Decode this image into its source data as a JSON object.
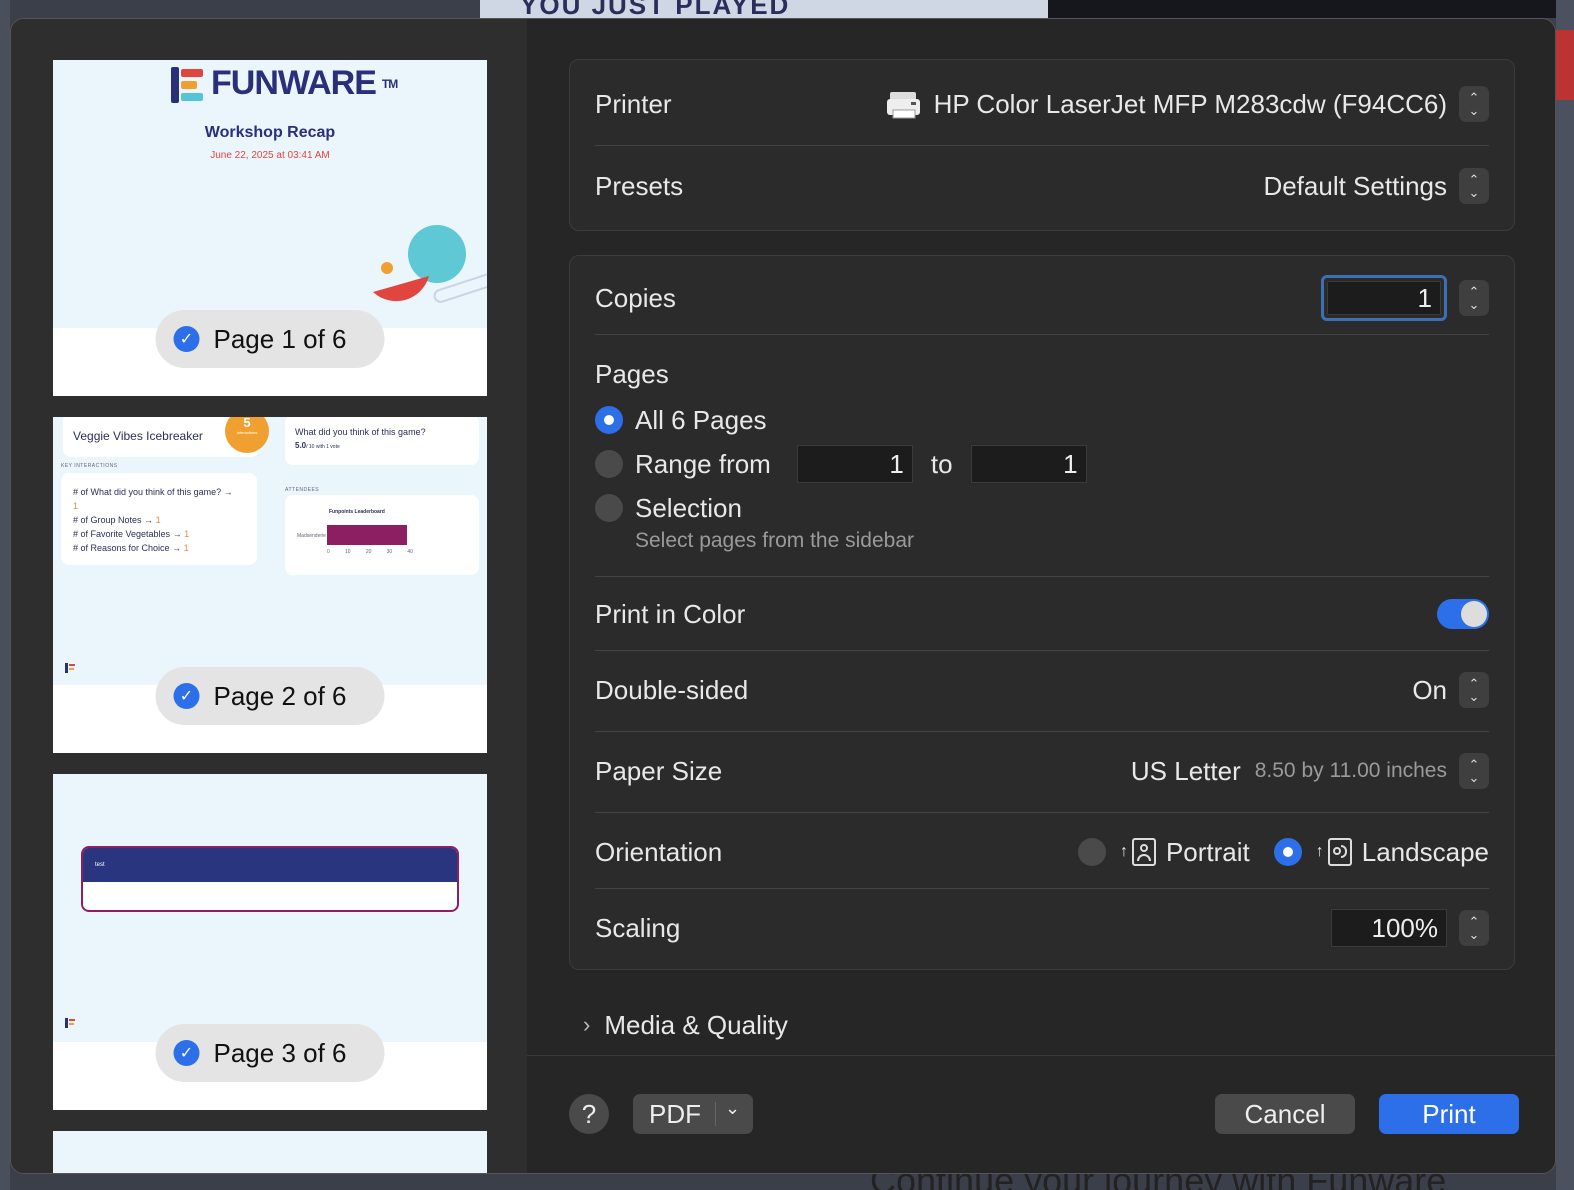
{
  "backdrop": {
    "top_text": "YOU JUST PLAYED",
    "bottom_text": "Continue your journey with Funware"
  },
  "sidebar": {
    "pages": [
      {
        "label": "Page 1 of 6"
      },
      {
        "label": "Page 2 of 6"
      },
      {
        "label": "Page 3 of 6"
      }
    ],
    "page1": {
      "logo_text": "FUNWARE",
      "logo_tm": "TM",
      "title": "Workshop Recap",
      "date": "June 22, 2025 at 03:41 AM"
    },
    "page2": {
      "game_title": "Veggie Vibes Icebreaker",
      "badge_count": "5",
      "badge_label": "Interactions",
      "question": "What did you think of this game?",
      "rating": "5.0",
      "rating_sub": "/ 10  with 1 vote",
      "key_interactions_label": "KEY INTERACTIONS",
      "interactions": [
        {
          "text": "# of What did you think of this game? →",
          "count": "1"
        },
        {
          "text": "# of Group Notes →",
          "count": "1"
        },
        {
          "text": "# of Favorite Vegetables →",
          "count": "1"
        },
        {
          "text": "# of Reasons for Choice →",
          "count": "1"
        }
      ],
      "attendees_label": "ATTENDEES",
      "leaderboard_title": "Funpoints Leaderboard",
      "leaderboard_name": "Madsenderie",
      "axis_ticks": [
        "0",
        "10",
        "20",
        "30",
        "40"
      ]
    },
    "page3": {
      "banner_text": "test"
    }
  },
  "printer": {
    "label": "Printer",
    "value": "HP Color LaserJet MFP M283cdw (F94CC6)"
  },
  "presets": {
    "label": "Presets",
    "value": "Default Settings"
  },
  "copies": {
    "label": "Copies",
    "value": "1"
  },
  "pages": {
    "label": "Pages",
    "all": "All 6 Pages",
    "range": "Range from",
    "range_from": "1",
    "range_to_label": "to",
    "range_to": "1",
    "selection": "Selection",
    "selection_hint": "Select pages from the sidebar",
    "selected": "all"
  },
  "color": {
    "label": "Print in Color",
    "on": true
  },
  "double_sided": {
    "label": "Double-sided",
    "value": "On"
  },
  "paper_size": {
    "label": "Paper Size",
    "value": "US Letter",
    "detail": "8.50 by 11.00 inches"
  },
  "orientation": {
    "label": "Orientation",
    "portrait": "Portrait",
    "landscape": "Landscape",
    "selected": "landscape"
  },
  "scaling": {
    "label": "Scaling",
    "value": "100%"
  },
  "media_quality": {
    "label": "Media & Quality"
  },
  "footer": {
    "help": "?",
    "pdf": "PDF",
    "cancel": "Cancel",
    "print": "Print"
  },
  "colors": {
    "accent": "#2d6fe8",
    "funware_navy": "#2a2f7a",
    "funware_red": "#e0463e",
    "bar_purple": "#8b1f62"
  }
}
